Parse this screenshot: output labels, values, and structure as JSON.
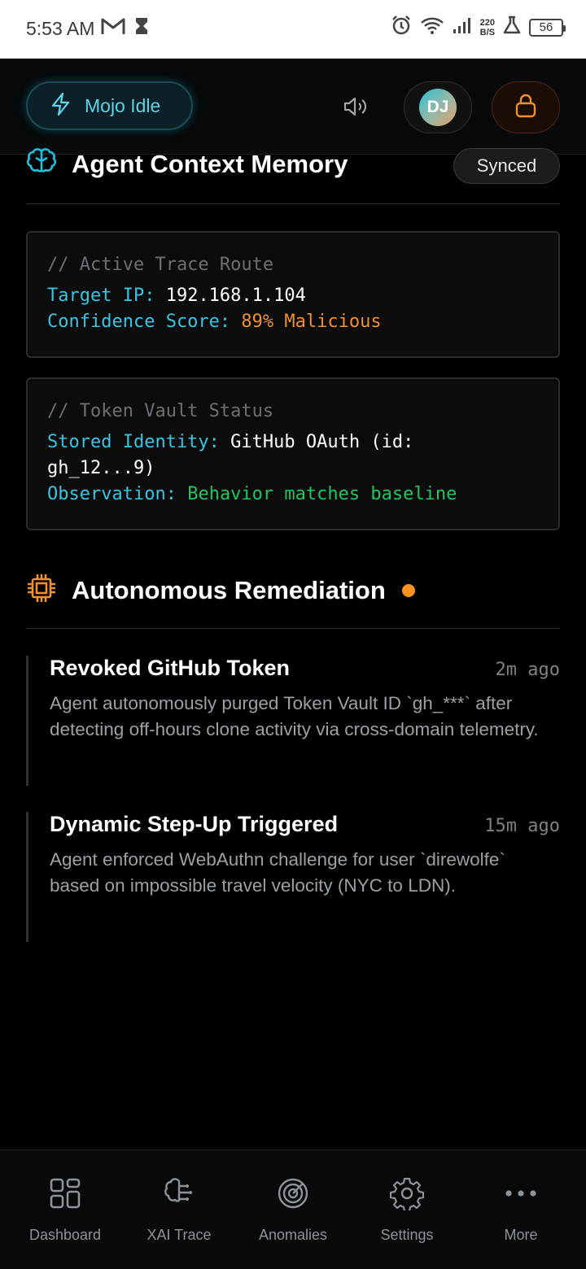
{
  "status_bar": {
    "time": "5:53 AM",
    "net_rate_top": "220",
    "net_rate_bottom": "B/S",
    "battery": "56",
    "icons": [
      "gmail-icon",
      "hourglass-icon",
      "alarm-icon",
      "wifi-icon",
      "signal-icon",
      "flask-icon",
      "battery-icon"
    ]
  },
  "header": {
    "mode_label": "Mojo Idle",
    "avatar_initials": "DJ",
    "colors": {
      "accent": "#5fd4e6",
      "lock": "#f0912f"
    }
  },
  "context_memory": {
    "title": "Agent Context Memory",
    "status": "Synced",
    "trace": {
      "comment": "// Active Trace Route",
      "target_key": "Target IP:",
      "target_value": "192.168.1.104",
      "confidence_key": "Confidence Score:",
      "confidence_value": "89% Malicious"
    },
    "vault": {
      "comment": "// Token Vault Status",
      "identity_key": "Stored Identity:",
      "identity_value_1": "GitHub OAuth (id:",
      "identity_value_2": "gh_12...9)",
      "observation_key": "Observation:",
      "observation_value": "Behavior matches baseline"
    }
  },
  "remediation": {
    "title": "Autonomous Remediation",
    "events": [
      {
        "title": "Revoked GitHub Token",
        "time": "2m ago",
        "desc": "Agent autonomously purged Token Vault ID `gh_***` after detecting off-hours clone activity via cross-domain telemetry."
      },
      {
        "title": "Dynamic Step-Up Triggered",
        "time": "15m ago",
        "desc": "Agent enforced WebAuthn challenge for user `direwolfe` based on impossible travel velocity (NYC to LDN)."
      }
    ]
  },
  "bottom_nav": [
    {
      "label": "Dashboard",
      "icon": "dashboard-icon"
    },
    {
      "label": "XAI Trace",
      "icon": "brain-icon"
    },
    {
      "label": "Anomalies",
      "icon": "radar-icon"
    },
    {
      "label": "Settings",
      "icon": "gear-icon"
    },
    {
      "label": "More",
      "icon": "more-dots-icon"
    }
  ]
}
